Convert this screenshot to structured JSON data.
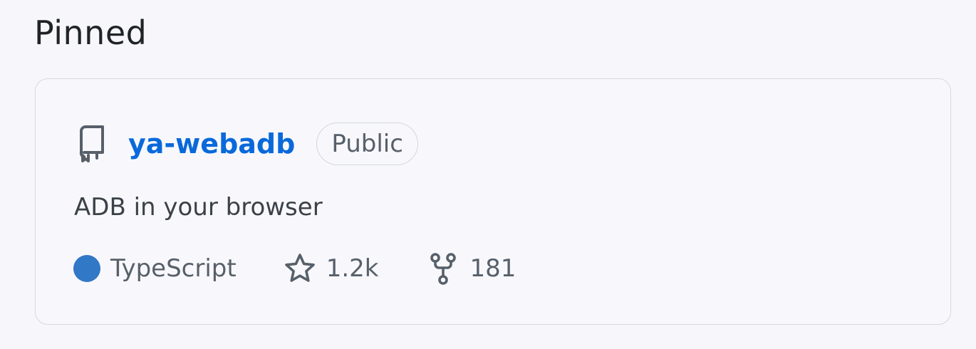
{
  "section": {
    "title": "Pinned"
  },
  "repo": {
    "name": "ya-webadb",
    "visibility": "Public",
    "description": "ADB in your browser",
    "language": "TypeScript",
    "language_color": "#3178c6",
    "stars": "1.2k",
    "forks": "181",
    "icons": {
      "repo": "repo-icon",
      "star": "star-icon",
      "fork": "fork-icon"
    }
  },
  "colors": {
    "link": "#0969da",
    "muted": "#57606a",
    "border": "#d5d9e2"
  }
}
